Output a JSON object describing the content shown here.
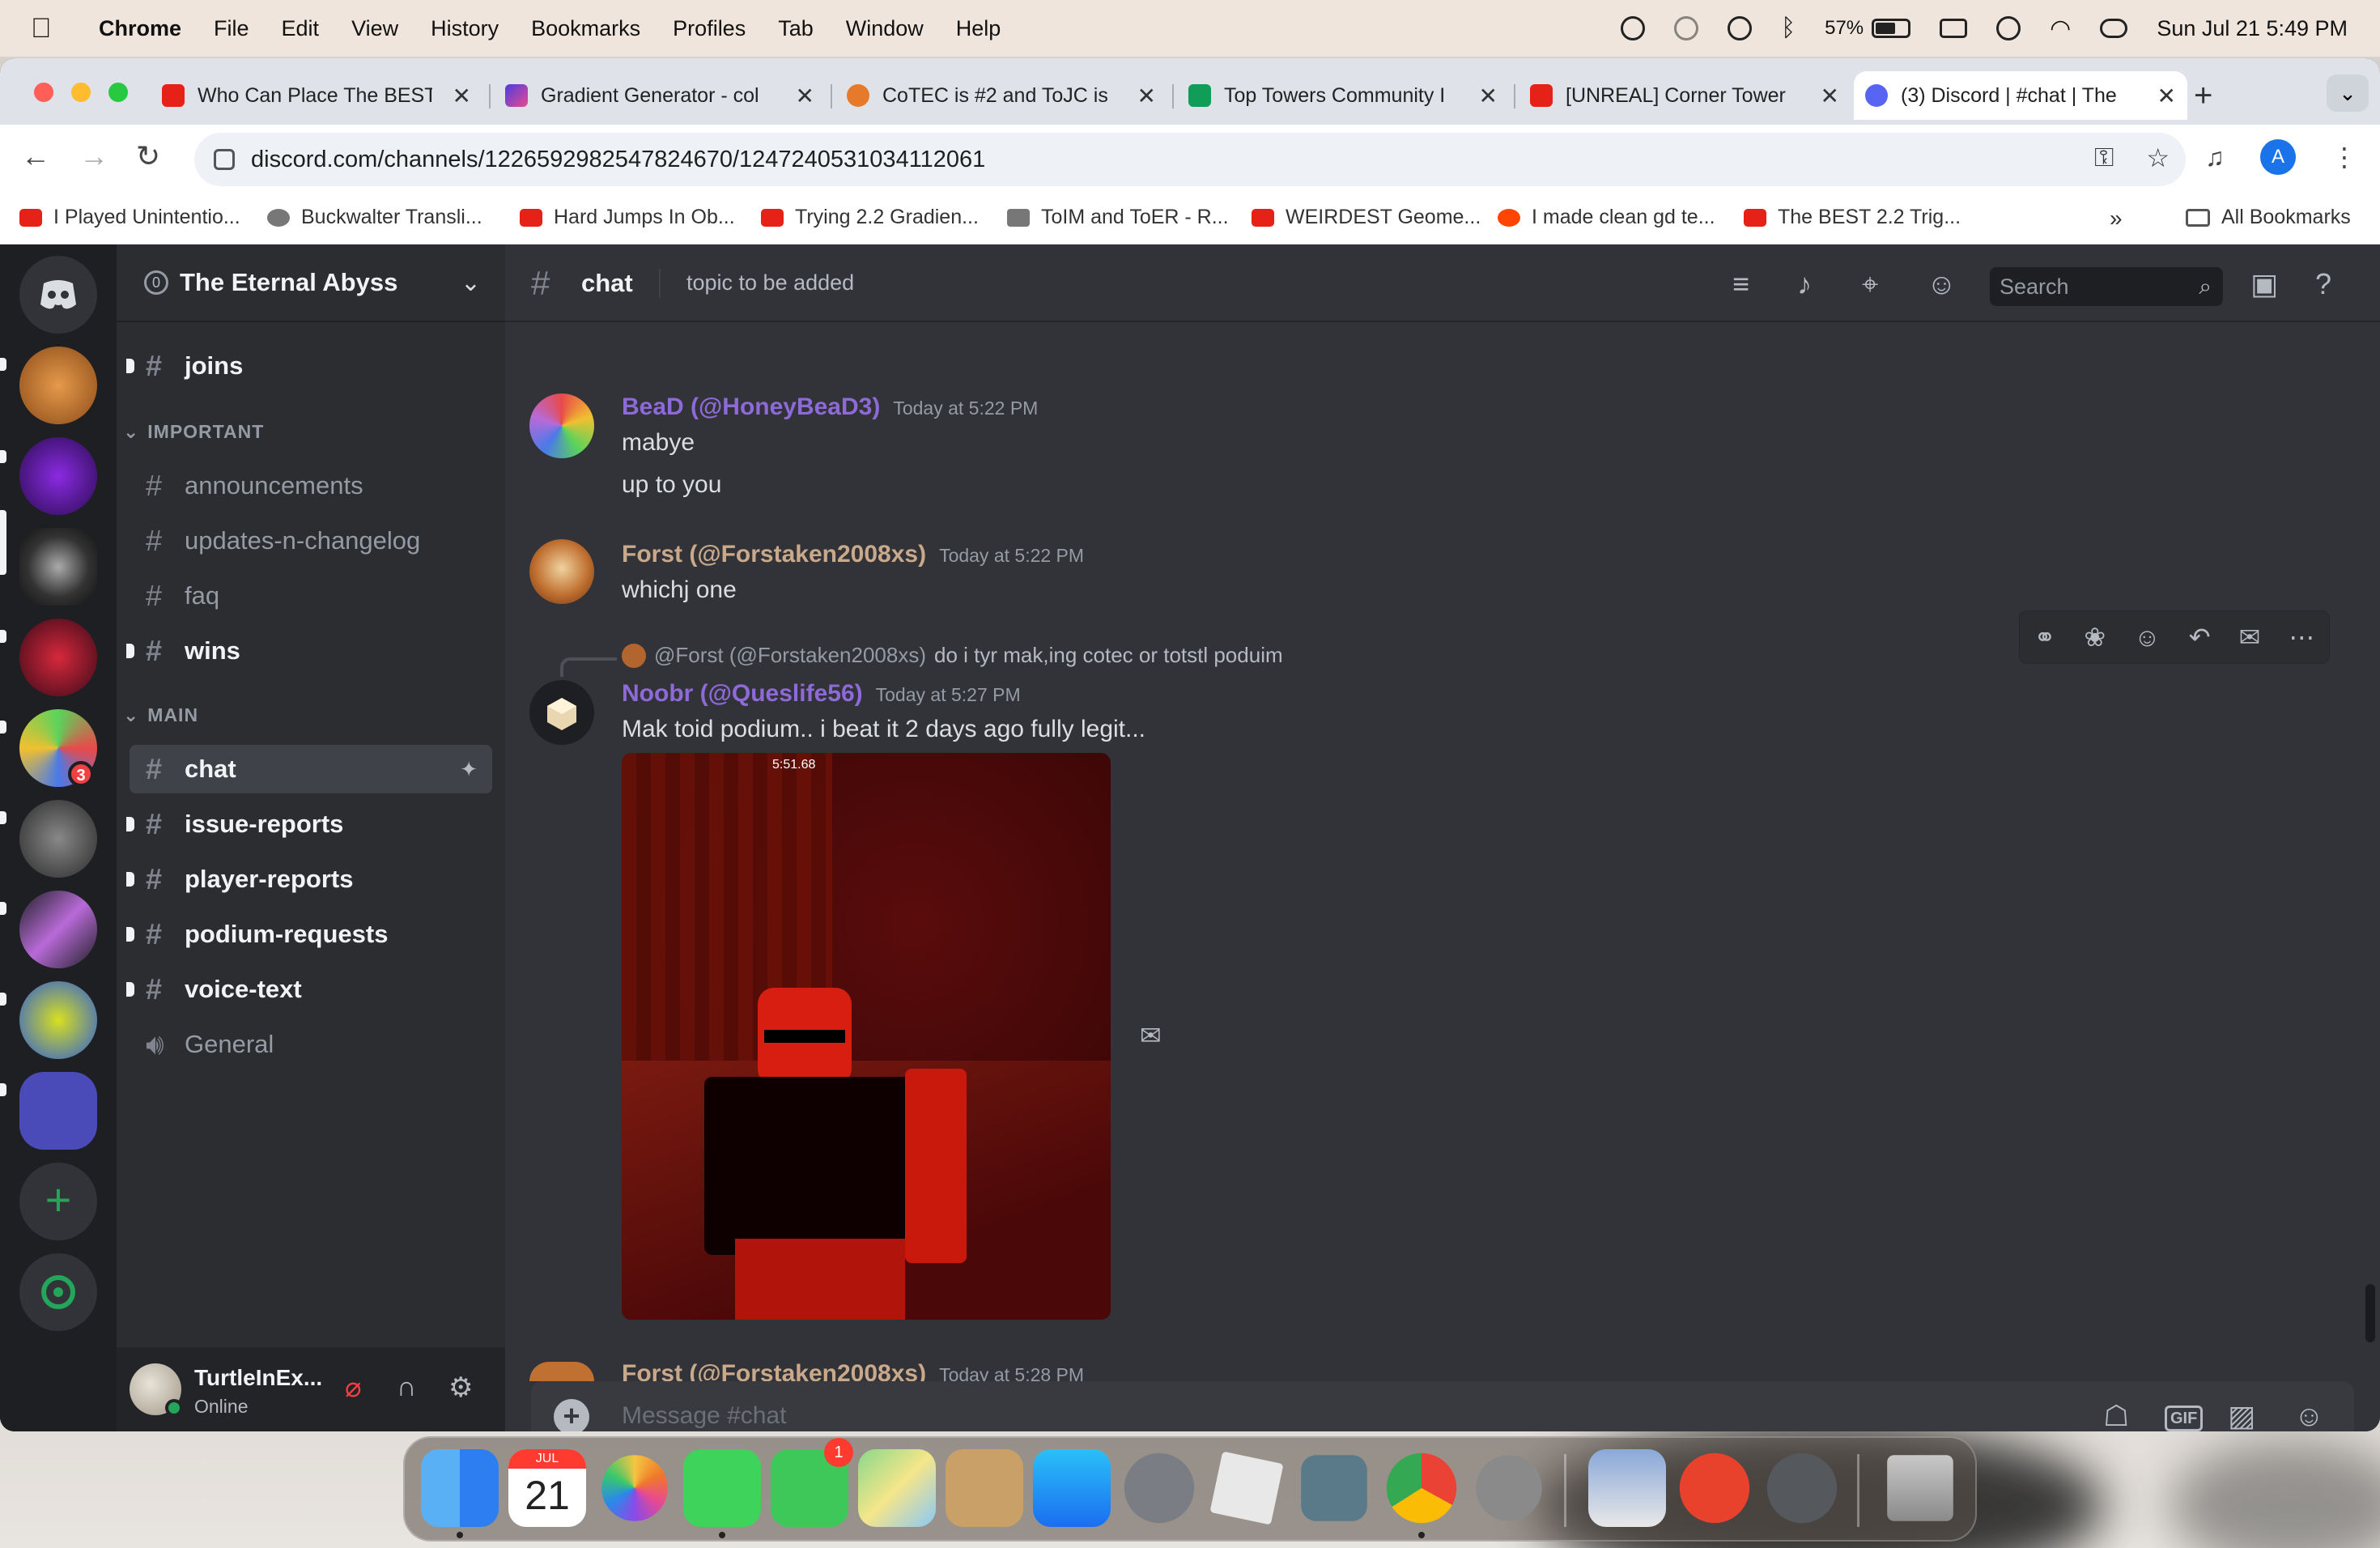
{
  "menubar": {
    "app_name": "Chrome",
    "menus": [
      "File",
      "Edit",
      "View",
      "History",
      "Bookmarks",
      "Profiles",
      "Tab",
      "Window",
      "Help"
    ],
    "battery": "57%",
    "datetime": "Sun Jul 21  5:49 PM"
  },
  "browser": {
    "tabs": [
      {
        "title": "Who Can Place The BEST",
        "favicon": "youtube-icon"
      },
      {
        "title": "Gradient Generator - col",
        "favicon": "gradient-icon"
      },
      {
        "title": "CoTEC is #2 and ToJC is",
        "favicon": "fire-icon"
      },
      {
        "title": "Top Towers Community I",
        "favicon": "sheets-icon"
      },
      {
        "title": "[UNREAL] Corner Tower",
        "favicon": "youtube-icon"
      },
      {
        "title": "(3) Discord | #chat | The",
        "favicon": "discord-icon",
        "active": true
      }
    ],
    "url": "discord.com/channels/1226592982547824670/1247240531034112061",
    "profile_initial": "A",
    "bookmarks": [
      "I Played Unintentio...",
      "Buckwalter Transli...",
      "Hard Jumps In Ob...",
      "Trying 2.2 Gradien...",
      "ToIM and ToER - R...",
      "WEIRDEST Geome...",
      "I made clean gd te...",
      "The BEST 2.2 Trig..."
    ],
    "all_bookmarks": "All Bookmarks"
  },
  "discord": {
    "server_badge": "3",
    "guild_name": "The Eternal Abyss",
    "guild_boost": "0",
    "channels": {
      "top": {
        "name": "joins"
      },
      "category_important": "IMPORTANT",
      "important": [
        {
          "name": "announcements"
        },
        {
          "name": "updates-n-changelog"
        },
        {
          "name": "faq"
        },
        {
          "name": "wins"
        }
      ],
      "category_main": "MAIN",
      "main": [
        {
          "name": "chat"
        },
        {
          "name": "issue-reports"
        },
        {
          "name": "player-reports"
        },
        {
          "name": "podium-requests"
        },
        {
          "name": "voice-text"
        },
        {
          "name": "General"
        }
      ]
    },
    "user": {
      "name": "TurtleInEx...",
      "status": "Online"
    },
    "chat": {
      "channel": "chat",
      "topic": "topic to be added",
      "search_placeholder": "Search",
      "messages": [
        {
          "author": "BeaD (@HoneyBeaD3)",
          "time": "Today at 5:22 PM",
          "lines": [
            "mabye",
            "up to you"
          ],
          "color": "#8e6ad8"
        },
        {
          "author": "Forst (@Forstaken2008xs)",
          "time": "Today at 5:22 PM",
          "lines": [
            "whichj one"
          ],
          "color": "#c9a98a"
        },
        {
          "reply_author": "@Forst (@Forstaken2008xs)",
          "reply_text": "do i tyr mak,ing cotec or totstl poduim",
          "author": "Noobr (@Queslife56)",
          "time": "Today at 5:27 PM",
          "lines": [
            "Mak toid podium.. i beat it 2 days ago fully legit..."
          ],
          "color": "#8e6ad8",
          "attachment_timer": "5:51.68"
        },
        {
          "author": "Forst (@Forstaken2008xs)",
          "time": "Today at 5:28 PM",
          "color": "#c9a98a"
        }
      ],
      "composer_placeholder": "Message #chat",
      "gif_label": "GIF"
    }
  }
}
